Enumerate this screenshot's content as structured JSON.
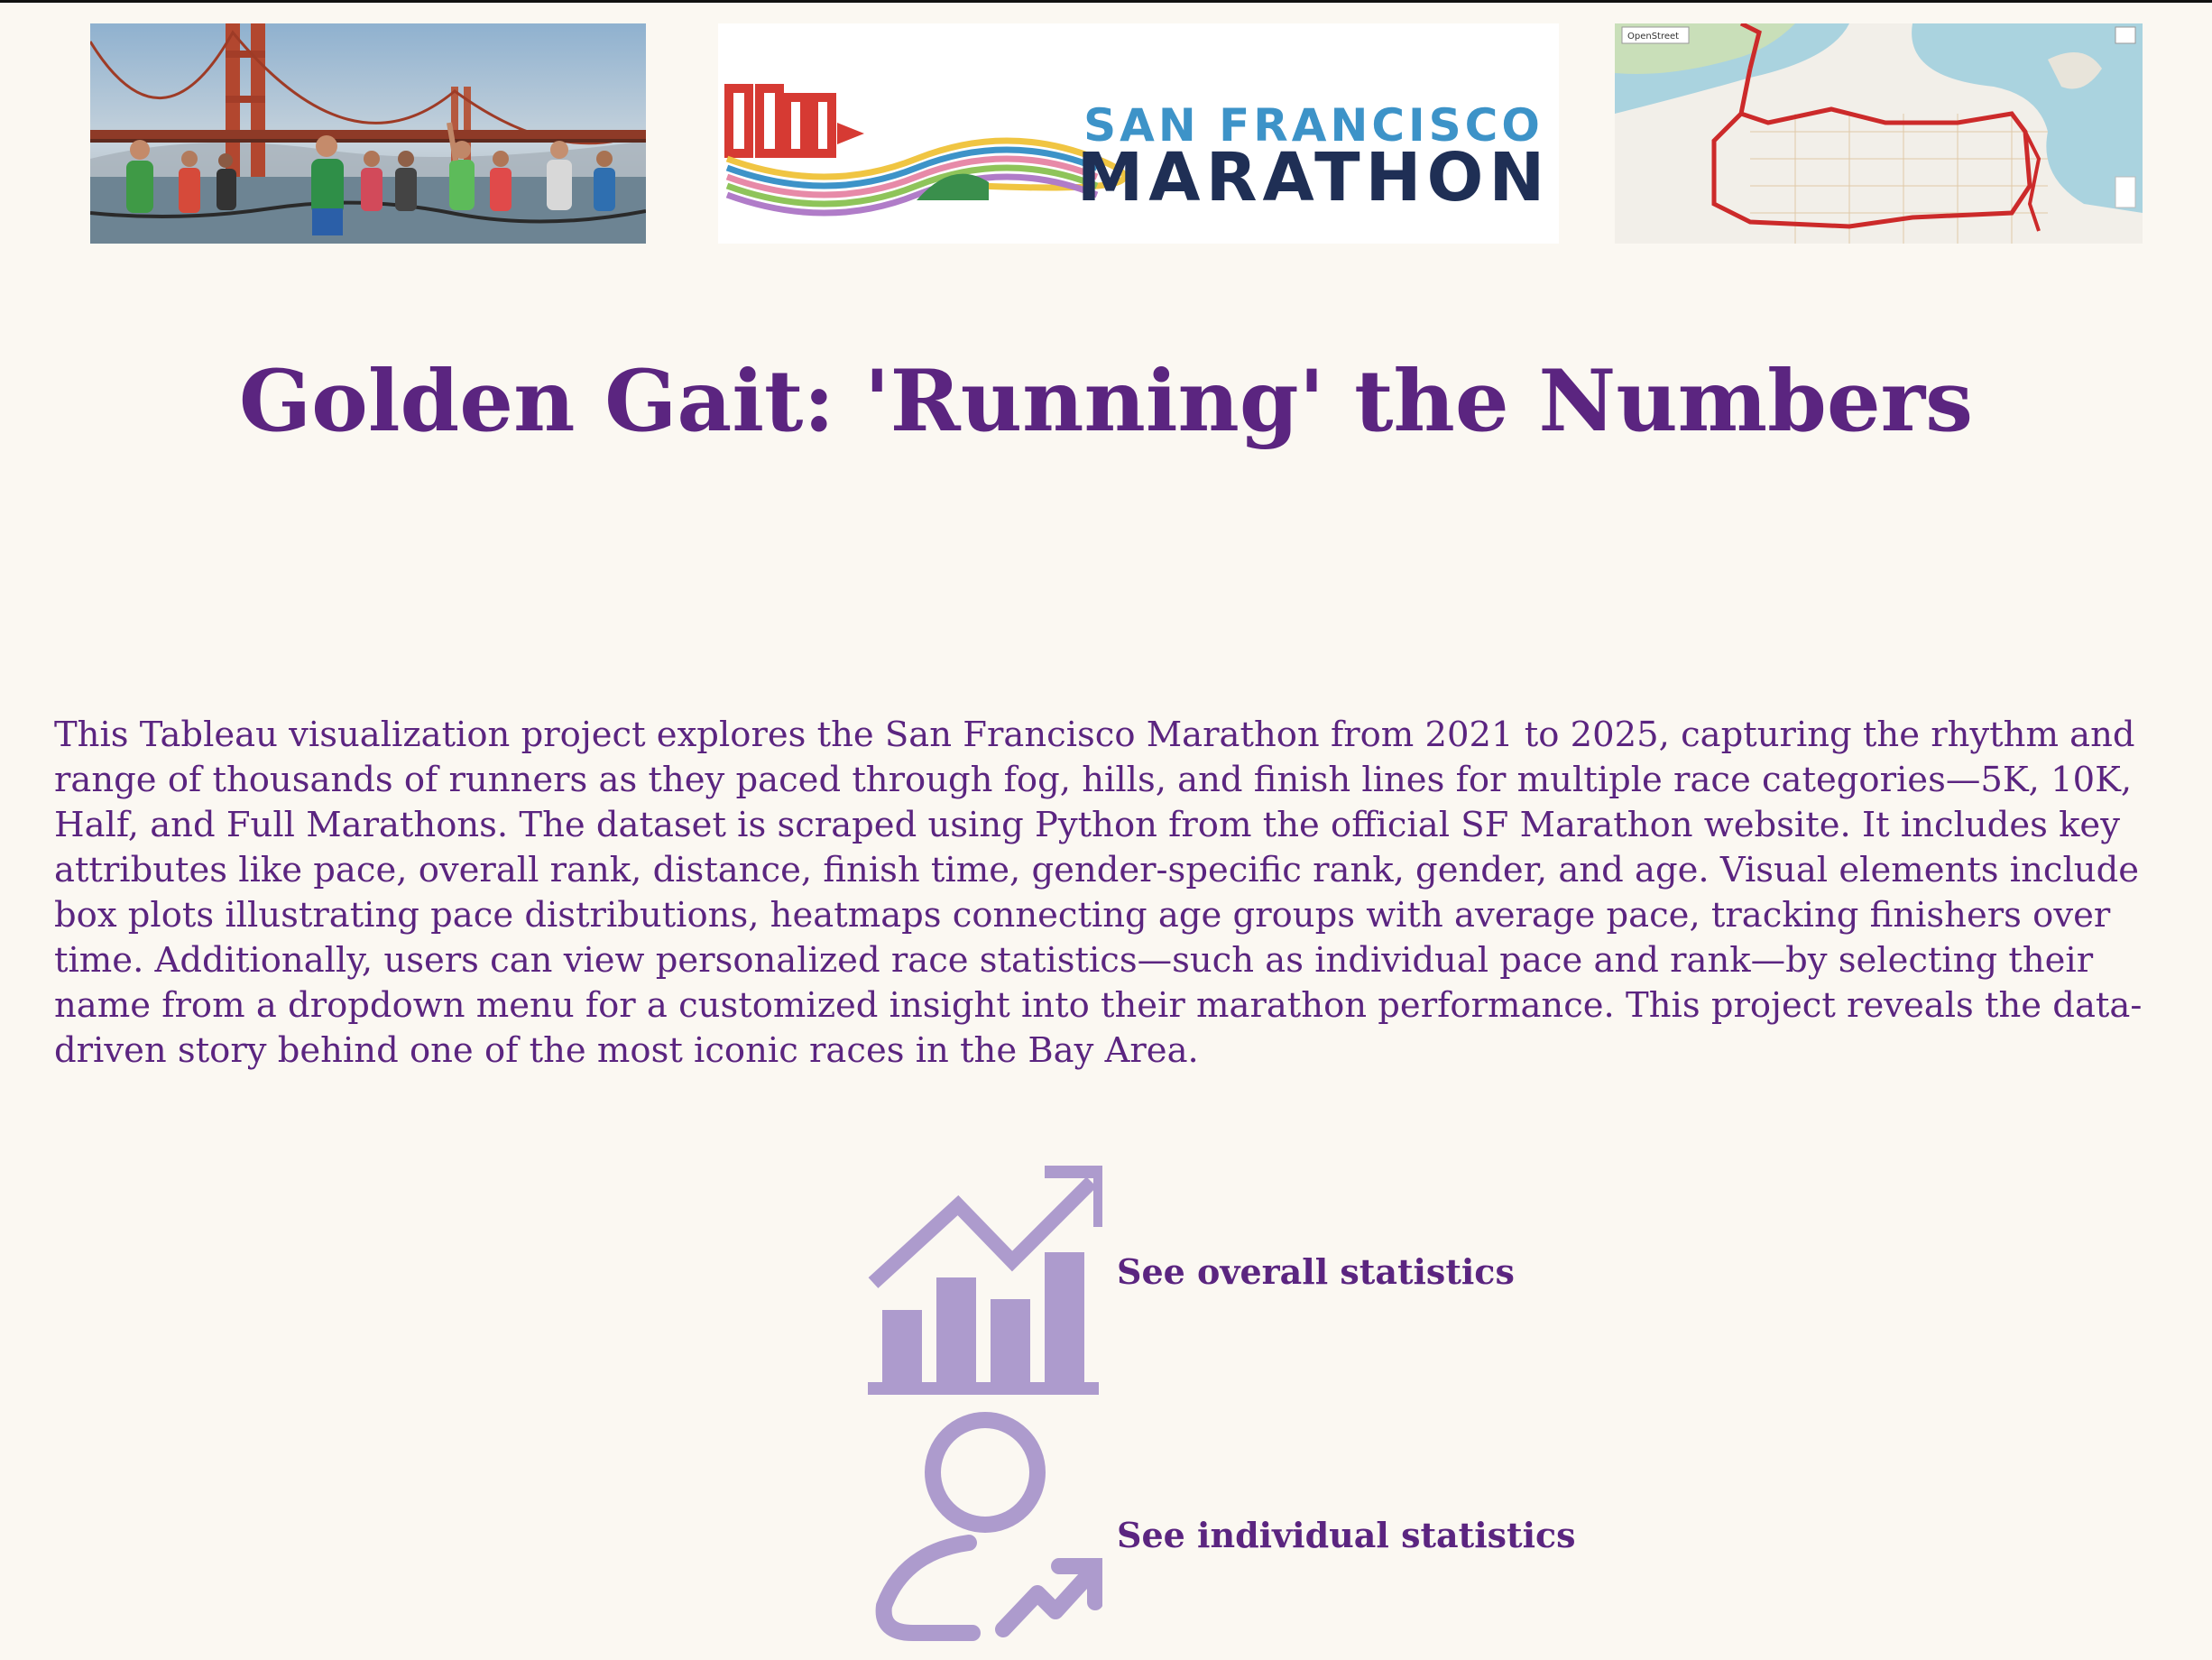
{
  "header": {
    "logo_text": {
      "line1": "SAN FRANCISCO",
      "line2": "MARATHON"
    },
    "map_control_label": "OpenStreet"
  },
  "title": "Golden Gait: 'Running' the Numbers",
  "description": "This Tableau visualization project explores the San Francisco Marathon from 2021 to 2025, capturing the rhythm and range of thousands of runners as they paced through fog, hills, and finish lines for multiple race categories—5K, 10K, Half, and Full Marathons. The dataset is scraped using Python from the official SF Marathon website. It includes key attributes like pace, overall rank, distance, finish time, gender-specific rank, gender, and age. Visual elements include box plots illustrating pace distributions, heatmaps connecting age groups with average pace, tracking finishers over time. Additionally, users can view personalized race statistics—such as individual pace and rank—by selecting their name from a dropdown menu for a customized insight into their marathon performance. This project reveals the data-driven story behind one of the most iconic races in the Bay Area.",
  "nav": {
    "overall": {
      "label": "See overall statistics",
      "icon": "chart-trend-up-icon"
    },
    "individual": {
      "label": "See individual statistics",
      "icon": "user-trend-icon"
    }
  },
  "colors": {
    "text": "#5b2580",
    "icon": "#ad9bcd",
    "background": "#fbf8f2",
    "logo_red": "#d63a33",
    "logo_blue": "#3d93c8",
    "logo_navy": "#1f2f55"
  }
}
